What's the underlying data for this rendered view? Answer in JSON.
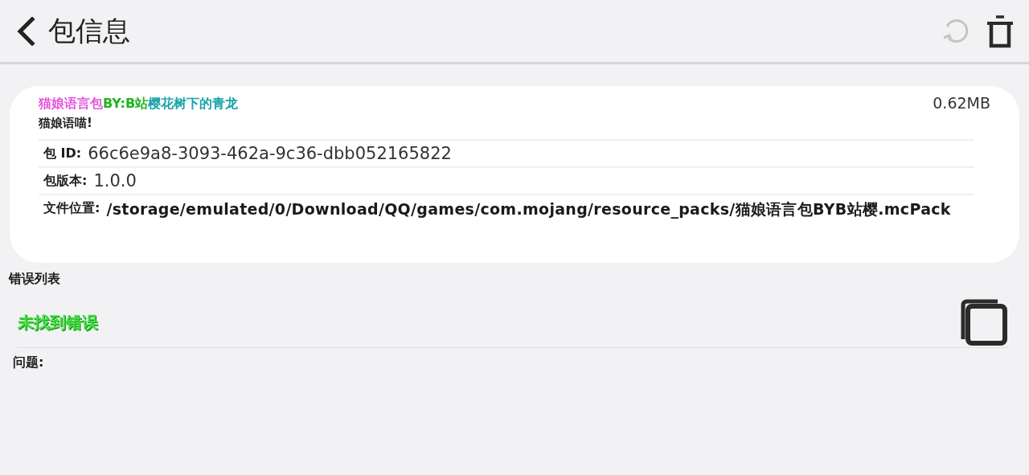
{
  "header": {
    "title": "包信息",
    "refresh_disabled": true
  },
  "pack": {
    "title_parts": [
      {
        "text": "猫娘语言包",
        "color": "#e555dd"
      },
      {
        "text": "BY:B站",
        "color": "#1fb41f"
      },
      {
        "text": "樱花树下的青龙",
        "color": "#17a3a8"
      }
    ],
    "size": "0.62MB",
    "description": "猫娘语喵!",
    "fields": [
      {
        "label": "包 ID:",
        "value": "66c6e9a8-3093-462a-9c36-dbb052165822",
        "kind": "plain"
      },
      {
        "label": "包版本:",
        "value": "1.0.0",
        "kind": "plain"
      },
      {
        "label": "文件位置:",
        "value": "/storage/emulated/0/Download/QQ/games/com.mojang/resource_packs/猫娘语言包BYB站樱.mcPack",
        "kind": "path"
      }
    ]
  },
  "errors": {
    "heading": "错误列表",
    "status": "未找到错误",
    "problems_label": "问题:"
  }
}
